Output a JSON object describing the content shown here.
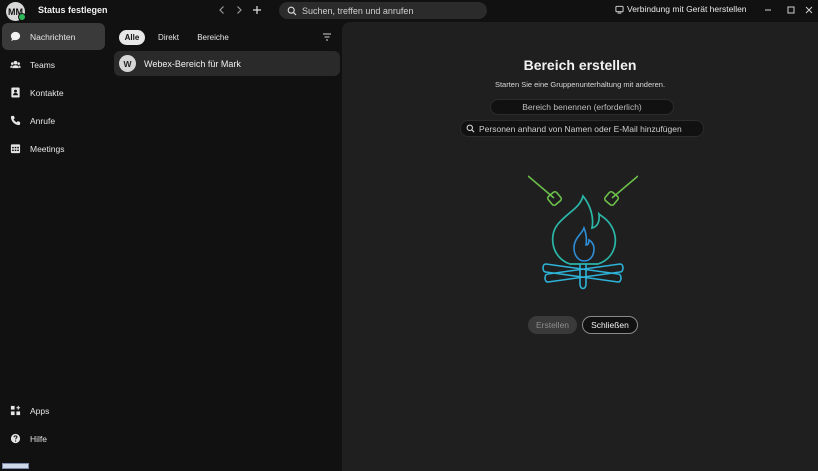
{
  "topbar": {
    "avatar_initials": "MM",
    "status_label": "Status festlegen",
    "search_placeholder": "Suchen, treffen und anrufen",
    "connect_label": "Verbindung mit Gerät herstellen"
  },
  "sidebar": {
    "items": [
      {
        "label": "Nachrichten",
        "icon": "chat-bubble-icon"
      },
      {
        "label": "Teams",
        "icon": "people-icon"
      },
      {
        "label": "Kontakte",
        "icon": "contacts-icon"
      },
      {
        "label": "Anrufe",
        "icon": "phone-icon"
      },
      {
        "label": "Meetings",
        "icon": "calendar-icon"
      }
    ],
    "bottom_items": [
      {
        "label": "Apps",
        "icon": "apps-icon"
      },
      {
        "label": "Hilfe",
        "icon": "help-icon"
      }
    ]
  },
  "list": {
    "filters": [
      "Alle",
      "Direkt",
      "Bereiche"
    ],
    "active_filter": "Alle",
    "spaces": [
      {
        "avatar": "W",
        "name": "Webex-Bereich für Mark"
      }
    ]
  },
  "create_space": {
    "title": "Bereich erstellen",
    "subtitle": "Starten Sie eine Gruppenunterhaltung mit anderen.",
    "name_placeholder": "Bereich benennen (erforderlich)",
    "people_placeholder": "Personen anhand von Namen oder E-Mail hinzufügen",
    "create_label": "Erstellen",
    "close_label": "Schließen"
  },
  "colors": {
    "background": "#111111",
    "main_panel": "#1f1f1f",
    "active_item": "#3a3a3a",
    "presence_green": "#2fb85a",
    "illustration_green": "#6cc04a",
    "illustration_cyan": "#2eb3d8"
  }
}
